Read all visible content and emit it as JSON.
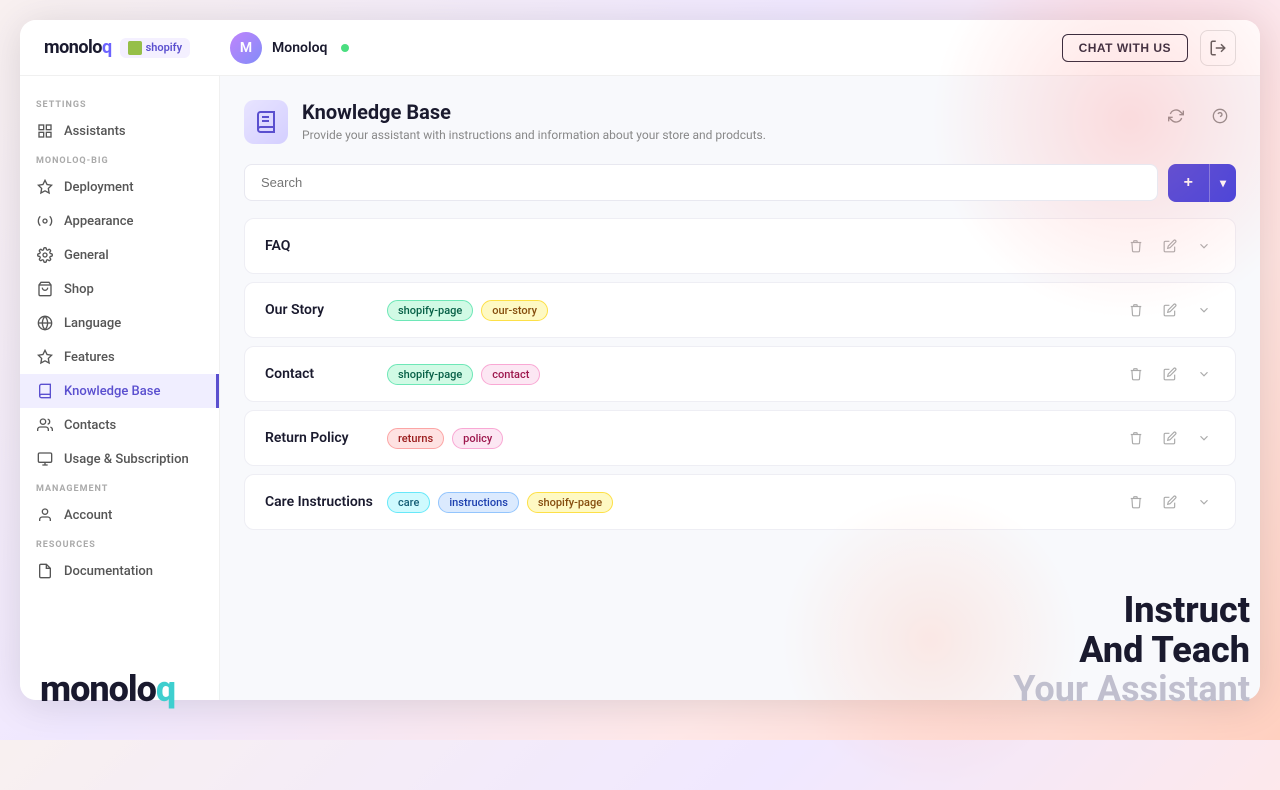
{
  "brand": {
    "name_part1": "monolo",
    "name_part2": "q",
    "shopify_label": "shopify"
  },
  "navbar": {
    "user_name": "Monoloq",
    "chat_btn_label": "CHAT WITH US",
    "exit_icon": "→"
  },
  "sidebar": {
    "settings_label": "SETTINGS",
    "monoloq_big_label": "MONOLOQ-BIG",
    "management_label": "MANAGEMENT",
    "resources_label": "RESOURCES",
    "items_settings": [
      {
        "label": "Assistants",
        "icon": "📋"
      }
    ],
    "items_monoloq": [
      {
        "label": "Deployment",
        "icon": "🚀"
      },
      {
        "label": "Appearance",
        "icon": "🎨"
      },
      {
        "label": "General",
        "icon": "⚙️"
      },
      {
        "label": "Shop",
        "icon": "🛍️"
      },
      {
        "label": "Language",
        "icon": "🌐"
      },
      {
        "label": "Features",
        "icon": "✨"
      },
      {
        "label": "Knowledge Base",
        "icon": "📚",
        "active": true
      }
    ],
    "items_management": [
      {
        "label": "Contacts",
        "icon": "👥"
      },
      {
        "label": "Account",
        "icon": "👤"
      }
    ],
    "items_resources": [
      {
        "label": "Usage & Subscription",
        "icon": "📊"
      },
      {
        "label": "Documentation",
        "icon": "📄"
      }
    ]
  },
  "page": {
    "title": "Knowledge Base",
    "subtitle": "Provide your assistant with instructions and information about your store and prodcuts.",
    "search_placeholder": "Search"
  },
  "knowledge_items": [
    {
      "name": "FAQ",
      "tags": []
    },
    {
      "name": "Our Story",
      "tags": [
        {
          "label": "shopify-page",
          "color": "green"
        },
        {
          "label": "our-story",
          "color": "yellow"
        }
      ]
    },
    {
      "name": "Contact",
      "tags": [
        {
          "label": "shopify-page",
          "color": "green"
        },
        {
          "label": "contact",
          "color": "pink"
        }
      ]
    },
    {
      "name": "Return Policy",
      "tags": [
        {
          "label": "returns",
          "color": "red"
        },
        {
          "label": "policy",
          "color": "pink"
        }
      ]
    },
    {
      "name": "Care Instructions",
      "tags": [
        {
          "label": "care",
          "color": "cyan"
        },
        {
          "label": "instructions",
          "color": "blue"
        },
        {
          "label": "shopify-page",
          "color": "yellow"
        }
      ]
    }
  ],
  "promo": {
    "line1": "Instruct",
    "line2": "And Teach",
    "line3": "Your Assistant"
  },
  "bottom_logo": {
    "part1": "monolo",
    "part2": "q"
  }
}
